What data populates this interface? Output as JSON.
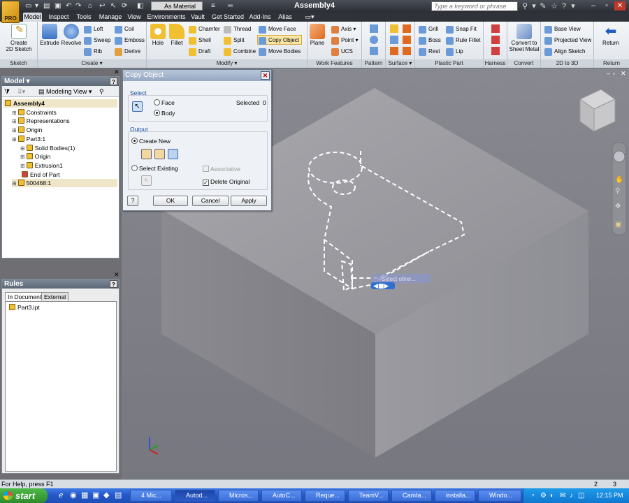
{
  "title_bar": {
    "logo_text": "PRO",
    "material_value": "As Material",
    "document_title": "Assembly4",
    "search_placeholder": "Type a keyword or phrase",
    "window_buttons": [
      "–",
      "▫",
      "✕"
    ]
  },
  "ribbon": {
    "tabs": [
      "Model",
      "Inspect",
      "Tools",
      "Manage",
      "View",
      "Environments",
      "Vault",
      "Get Started",
      "Add-Ins",
      "Alias"
    ],
    "active_tab": "Model",
    "groups": {
      "sketch": {
        "label": "Sketch",
        "create_2d_sketch": "Create\n2D Sketch"
      },
      "create": {
        "label": "Create",
        "extrude": "Extrude",
        "revolve": "Revolve",
        "loft": "Loft",
        "sweep": "Sweep",
        "rib": "Rib",
        "coil": "Coil",
        "emboss": "Emboss",
        "derive": "Derive"
      },
      "modify": {
        "label": "Modify",
        "hole": "Hole",
        "fillet": "Fillet",
        "chamfer": "Chamfer",
        "shell": "Shell",
        "draft": "Draft",
        "thread": "Thread",
        "split": "Split",
        "combine": "Combine",
        "move_face": "Move Face",
        "copy_object": "Copy Object",
        "move_bodies": "Move Bodies"
      },
      "work_features": {
        "label": "Work Features",
        "plane": "Plane",
        "axis": "Axis",
        "point": "Point",
        "ucs": "UCS"
      },
      "pattern": {
        "label": "Pattern"
      },
      "surface": {
        "label": "Surface"
      },
      "plastic_part": {
        "label": "Plastic Part",
        "grill": "Grill",
        "boss": "Boss",
        "rest": "Rest",
        "snap_fit": "Snap Fit",
        "rule_fillet": "Rule Fillet",
        "lip": "Lip"
      },
      "harness": {
        "label": "Harness"
      },
      "convert": {
        "label": "Convert",
        "convert_sheet_metal": "Convert to\nSheet Metal"
      },
      "two_d_to_3d": {
        "label": "2D to 3D",
        "base_view": "Base View",
        "projected_view": "Projected View",
        "align_sketch": "Align Sketch"
      },
      "return": {
        "label": "Return",
        "return": "Return"
      }
    }
  },
  "model_panel": {
    "title": "Model",
    "view_mode": "Modeling View",
    "tree": [
      {
        "label": "Assembly4",
        "level": 0,
        "bold": true
      },
      {
        "label": "Constraints",
        "level": 1
      },
      {
        "label": "Representations",
        "level": 1
      },
      {
        "label": "Origin",
        "level": 1
      },
      {
        "label": "Part3:1",
        "level": 1
      },
      {
        "label": "Solid Bodies(1)",
        "level": 2
      },
      {
        "label": "Origin",
        "level": 2
      },
      {
        "label": "Extrusion1",
        "level": 2
      },
      {
        "label": "End of Part",
        "level": 2
      },
      {
        "label": "500468:1",
        "level": 1
      }
    ]
  },
  "rules_panel": {
    "title": "Rules",
    "tabs": [
      "In Document",
      "External"
    ],
    "items": [
      "Part3.ipt"
    ]
  },
  "copy_object_dialog": {
    "title": "Copy Object",
    "select_label": "Select",
    "face_option": "Face",
    "body_option": "Body",
    "selected_text": "Selected",
    "selected_count": "0",
    "output_label": "Output",
    "create_new": "Create New",
    "select_existing": "Select Existing",
    "associative": "Associative",
    "delete_original": "Delete Original",
    "ok": "OK",
    "cancel": "Cancel",
    "apply": "Apply"
  },
  "viewport": {
    "hover_hint": "Select other..."
  },
  "status_bar": {
    "help_text": "For Help, press F1",
    "counter_a": "2",
    "counter_b": "3"
  },
  "taskbar": {
    "start_label": "start",
    "tasks": [
      "4 Mic...",
      "Autod...",
      "Micros...",
      "AutoC...",
      "Reque...",
      "TeamV...",
      "Camta...",
      "installa...",
      "Windo..."
    ],
    "clock": "12:15 PM"
  },
  "colors": {
    "accent_yellow": "#f6c445",
    "ribbon_bg": "#e6eaef",
    "viewport_bg": "#7f7f87",
    "taskbar_blue": "#2356c6"
  }
}
